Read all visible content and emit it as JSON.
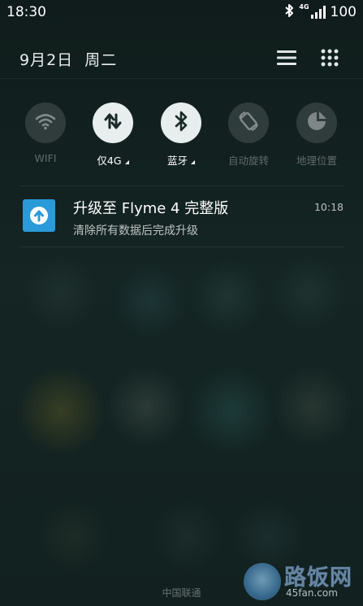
{
  "status_bar": {
    "time": "18:30",
    "network_type": "4G",
    "battery": "100",
    "icons": [
      "bluetooth-icon",
      "signal-icon",
      "battery-text"
    ]
  },
  "header": {
    "date": "9月2日",
    "weekday": "周二",
    "list_icon": "menu-list-icon",
    "grid_icon": "grid-dots-icon"
  },
  "quick_toggles": [
    {
      "label": "WIFI",
      "icon": "wifi-icon",
      "active": false,
      "has_caret": false
    },
    {
      "label": "仅4G",
      "icon": "data-transfer-icon",
      "active": true,
      "has_caret": true
    },
    {
      "label": "蓝牙",
      "icon": "bluetooth-icon",
      "active": true,
      "has_caret": true
    },
    {
      "label": "自动旋转",
      "icon": "auto-rotate-icon",
      "active": false,
      "has_caret": false
    },
    {
      "label": "地理位置",
      "icon": "location-icon",
      "active": false,
      "has_caret": false
    }
  ],
  "notification": {
    "icon": "system-update-icon",
    "title": "升级至 Flyme 4 完整版",
    "time": "10:18",
    "body": "清除所有数据后完成升级"
  },
  "carrier": "中国联通",
  "watermark": {
    "name": "路饭网",
    "url": "45fan.com"
  },
  "colors": {
    "background": "#142523",
    "toggle_on": "#e7eeed",
    "toggle_off": "rgba(255,255,255,0.13)",
    "notification_icon": "#2a9ad9"
  }
}
